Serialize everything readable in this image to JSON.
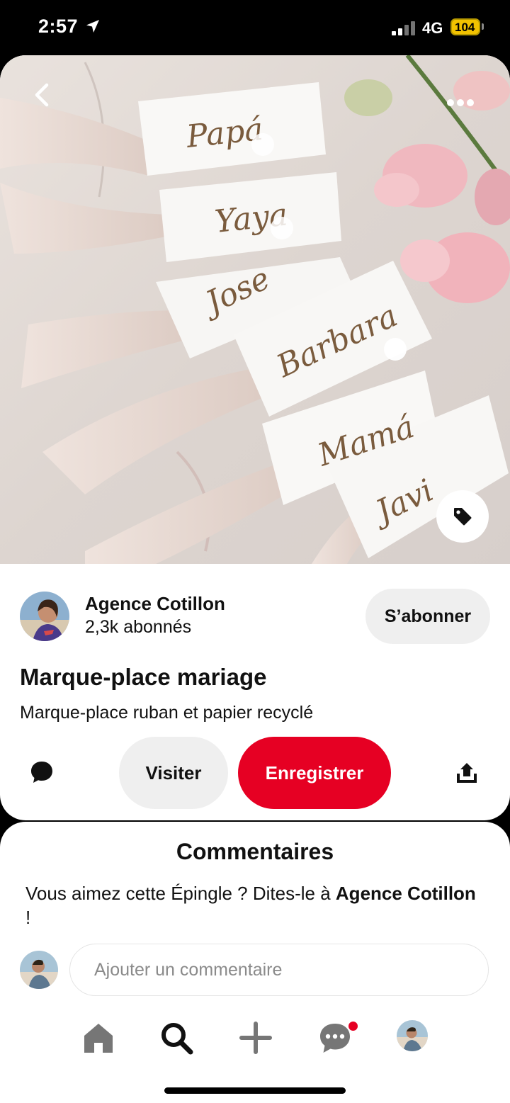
{
  "status_bar": {
    "time": "2:57",
    "network": "4G",
    "battery": "104"
  },
  "pin": {
    "image_description_icon": "place-card-photo",
    "creator": {
      "name": "Agence Cotillon",
      "followers": "2,3k abonnés",
      "follow_label": "S’abonner"
    },
    "title": "Marque-place mariage",
    "description": "Marque-place ruban et papier recyclé",
    "actions": {
      "visit_label": "Visiter",
      "save_label": "Enregistrer"
    },
    "place_card_names": [
      "Papá",
      "Yaya",
      "Jose",
      "Barbara",
      "Mamá",
      "Javi"
    ]
  },
  "comments": {
    "title": "Commentaires",
    "prompt_prefix": "Vous aimez cette Épingle ? Dites-le à ",
    "prompt_name": "Agence Cotillon",
    "prompt_suffix": " !",
    "input_placeholder": "Ajouter un commentaire"
  },
  "nav": {
    "items": [
      "home-icon",
      "search-icon",
      "plus-icon",
      "messages-icon",
      "profile-avatar"
    ]
  },
  "colors": {
    "brand_red": "#e60023",
    "button_gray": "#efefef"
  }
}
